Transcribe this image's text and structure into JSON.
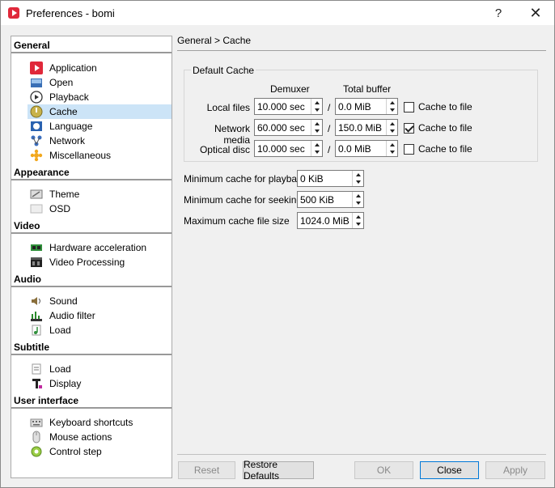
{
  "window": {
    "title": "Preferences - bomi",
    "help": "?",
    "close": "✕"
  },
  "nav": {
    "sections": [
      {
        "label": "General",
        "items": [
          {
            "label": "Application",
            "icon": "application-icon"
          },
          {
            "label": "Open",
            "icon": "open-icon"
          },
          {
            "label": "Playback",
            "icon": "playback-icon"
          },
          {
            "label": "Cache",
            "icon": "cache-icon",
            "selected": true
          },
          {
            "label": "Language",
            "icon": "language-icon"
          },
          {
            "label": "Network",
            "icon": "network-icon"
          },
          {
            "label": "Miscellaneous",
            "icon": "miscellaneous-icon"
          }
        ]
      },
      {
        "label": "Appearance",
        "items": [
          {
            "label": "Theme",
            "icon": "theme-icon"
          },
          {
            "label": "OSD",
            "icon": "osd-icon"
          }
        ]
      },
      {
        "label": "Video",
        "items": [
          {
            "label": "Hardware acceleration",
            "icon": "hardware-icon"
          },
          {
            "label": "Video Processing",
            "icon": "film-icon"
          }
        ]
      },
      {
        "label": "Audio",
        "items": [
          {
            "label": "Sound",
            "icon": "speaker-icon"
          },
          {
            "label": "Audio filter",
            "icon": "audio-filter-icon"
          },
          {
            "label": "Load",
            "icon": "music-note-icon"
          }
        ]
      },
      {
        "label": "Subtitle",
        "items": [
          {
            "label": "Load",
            "icon": "subtitle-file-icon"
          },
          {
            "label": "Display",
            "icon": "text-icon"
          }
        ]
      },
      {
        "label": "User interface",
        "items": [
          {
            "label": "Keyboard shortcuts",
            "icon": "keyboard-icon"
          },
          {
            "label": "Mouse actions",
            "icon": "mouse-icon"
          },
          {
            "label": "Control step",
            "icon": "control-step-icon"
          }
        ]
      }
    ]
  },
  "breadcrumb": "General > Cache",
  "default_cache": {
    "title": "Default Cache",
    "col_demuxer": "Demuxer",
    "col_total": "Total buffer",
    "slash": "/",
    "rows": [
      {
        "label": "Local files",
        "demuxer": "10.000 sec",
        "total": "0.0 MiB",
        "cache_label": "Cache to file",
        "checked": false
      },
      {
        "label": "Network media",
        "demuxer": "60.000 sec",
        "total": "150.0 MiB",
        "cache_label": "Cache to file",
        "checked": true
      },
      {
        "label": "Optical disc",
        "demuxer": "10.000 sec",
        "total": "0.0 MiB",
        "cache_label": "Cache to file",
        "checked": false
      }
    ]
  },
  "min_playback": {
    "label": "Minimum cache for playback",
    "value": "0 KiB"
  },
  "min_seeking": {
    "label": "Minimum cache for seeking",
    "value": "500 KiB"
  },
  "max_file": {
    "label": "Maximum cache file size",
    "value": "1024.0 MiB"
  },
  "buttons": {
    "reset": "Reset",
    "restore": "Restore Defaults",
    "ok": "OK",
    "close": "Close",
    "apply": "Apply"
  },
  "colors": {
    "accent": "#0078d7",
    "selection": "#cce4f7",
    "brand": "#e0283a"
  }
}
